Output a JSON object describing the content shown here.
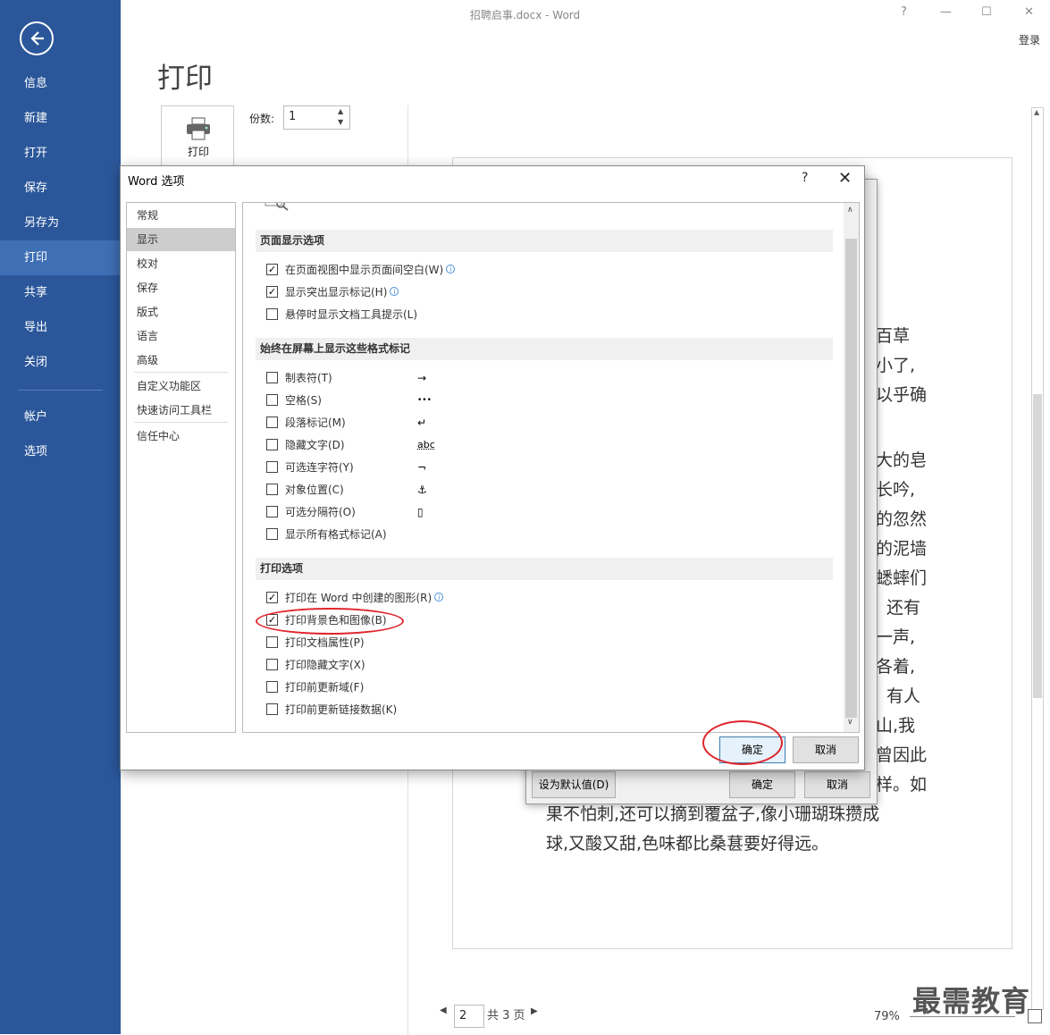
{
  "window": {
    "title": "招聘启事.docx - Word",
    "help": "?",
    "minimize": "—",
    "maximize": "☐",
    "close": "✕",
    "login": "登录"
  },
  "sidebar": {
    "items": [
      {
        "label": "信息"
      },
      {
        "label": "新建"
      },
      {
        "label": "打开"
      },
      {
        "label": "保存"
      },
      {
        "label": "另存为"
      },
      {
        "label": "打印"
      },
      {
        "label": "共享"
      },
      {
        "label": "导出"
      },
      {
        "label": "关闭"
      },
      {
        "label": "帐户"
      },
      {
        "label": "选项"
      }
    ],
    "active": "打印",
    "accent": "#2b579a"
  },
  "print": {
    "heading": "打印",
    "button_label": "打印",
    "copies_label": "份数:",
    "copies_value": "1"
  },
  "preview": {
    "lines": [
      "百草",
      "小了,",
      "以乎确",
      "大的皂",
      "长吟,",
      "的忽然",
      "的泥墙",
      "蟋蟀们",
      "。还有",
      "一声,",
      "各着,",
      "。有人",
      "山,我",
      "曾因此",
      "样。如",
      "果不怕刺,还可以摘到覆盆子,像小珊瑚珠攒成",
      "球,又酸又甜,色味都比桑葚要好得远。"
    ]
  },
  "pager": {
    "current": "2",
    "total": "共 3 页",
    "zoom": "79%"
  },
  "watermark": "最需教育",
  "back_dialog": {
    "default_button": "设为默认值(D)",
    "ok": "确定",
    "cancel": "取消"
  },
  "dialog": {
    "title": "Word 选项",
    "help": "?",
    "close": "✕",
    "categories": [
      {
        "label": "常规"
      },
      {
        "label": "显示"
      },
      {
        "label": "校对"
      },
      {
        "label": "保存"
      },
      {
        "label": "版式"
      },
      {
        "label": "语言"
      },
      {
        "label": "高级"
      },
      {
        "label": "自定义功能区"
      },
      {
        "label": "快速访问工具栏"
      },
      {
        "label": "信任中心"
      }
    ],
    "selected_category": "显示",
    "sections": {
      "page_display": {
        "heading": "页面显示选项",
        "options": [
          {
            "label": "在页面视图中显示页面间空白(W)",
            "checked": true,
            "info": true
          },
          {
            "label": "显示突出显示标记(H)",
            "checked": true,
            "info": true
          },
          {
            "label": "悬停时显示文档工具提示(L)",
            "checked": false,
            "info": false
          }
        ]
      },
      "format_marks": {
        "heading": "始终在屏幕上显示这些格式标记",
        "options": [
          {
            "label": "制表符(T)",
            "checked": false,
            "symbol": "→"
          },
          {
            "label": "空格(S)",
            "checked": false,
            "symbol": "•••"
          },
          {
            "label": "段落标记(M)",
            "checked": false,
            "symbol": "↵"
          },
          {
            "label": "隐藏文字(D)",
            "checked": false,
            "symbol": "abc"
          },
          {
            "label": "可选连字符(Y)",
            "checked": false,
            "symbol": "¬"
          },
          {
            "label": "对象位置(C)",
            "checked": false,
            "symbol": "⚓"
          },
          {
            "label": "可选分隔符(O)",
            "checked": false,
            "symbol": "▯"
          },
          {
            "label": "显示所有格式标记(A)",
            "checked": false,
            "symbol": ""
          }
        ]
      },
      "print_options": {
        "heading": "打印选项",
        "options": [
          {
            "label": "打印在 Word 中创建的图形(R)",
            "checked": true,
            "info": true
          },
          {
            "label": "打印背景色和图像(B)",
            "checked": true,
            "info": false
          },
          {
            "label": "打印文档属性(P)",
            "checked": false,
            "info": false
          },
          {
            "label": "打印隐藏文字(X)",
            "checked": false,
            "info": false
          },
          {
            "label": "打印前更新域(F)",
            "checked": false,
            "info": false
          },
          {
            "label": "打印前更新链接数据(K)",
            "checked": false,
            "info": false
          }
        ]
      }
    },
    "ok": "确定",
    "cancel": "取消",
    "highlight_color": "#e0252b"
  }
}
